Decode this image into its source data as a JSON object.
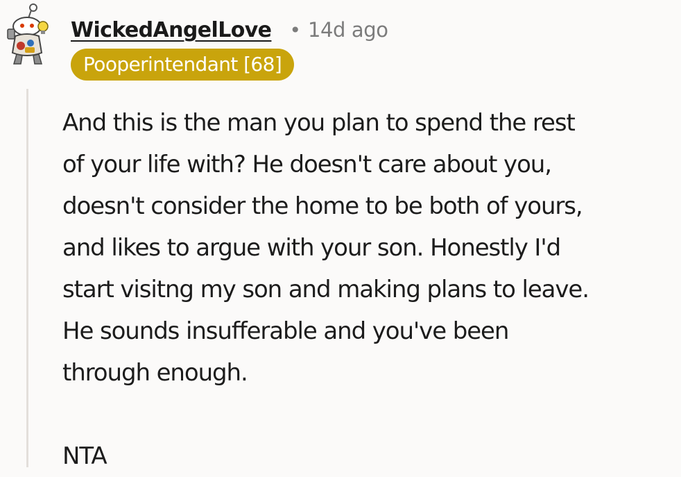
{
  "comment": {
    "username": "WickedAngelLove",
    "separator": "•",
    "timestamp": "14d ago",
    "flair": "Pooperintendant [68]",
    "flair_color": "#c9a40c",
    "avatar": "snoo-avatar",
    "body_lines": [
      "And this is the man you plan to spend the rest",
      "of your life with? He doesn't care about you,",
      "doesn't consider the home to be both of yours,",
      "and likes to argue with your son. Honestly I'd",
      "start visitng my son and making plans to leave.",
      "He sounds insufferable and you've been",
      "through enough."
    ],
    "verdict": "NTA"
  }
}
